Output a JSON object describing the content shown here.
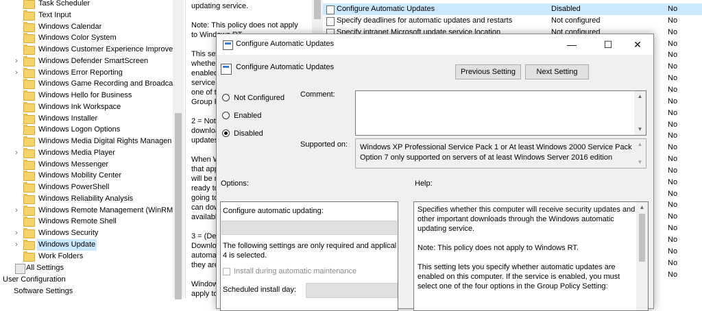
{
  "tree": {
    "items": [
      {
        "label": "Task Scheduler",
        "chev": "",
        "icon": "folder"
      },
      {
        "label": "Text Input",
        "chev": "",
        "icon": "folder"
      },
      {
        "label": "Windows Calendar",
        "chev": "",
        "icon": "folder"
      },
      {
        "label": "Windows Color System",
        "chev": "",
        "icon": "folder"
      },
      {
        "label": "Windows Customer Experience Improve",
        "chev": "",
        "icon": "folder"
      },
      {
        "label": "Windows Defender SmartScreen",
        "chev": "›",
        "icon": "folder"
      },
      {
        "label": "Windows Error Reporting",
        "chev": "›",
        "icon": "folder"
      },
      {
        "label": "Windows Game Recording and Broadca",
        "chev": "",
        "icon": "folder"
      },
      {
        "label": "Windows Hello for Business",
        "chev": "",
        "icon": "folder"
      },
      {
        "label": "Windows Ink Workspace",
        "chev": "",
        "icon": "folder"
      },
      {
        "label": "Windows Installer",
        "chev": "",
        "icon": "folder"
      },
      {
        "label": "Windows Logon Options",
        "chev": "",
        "icon": "folder"
      },
      {
        "label": "Windows Media Digital Rights Managen",
        "chev": "",
        "icon": "folder"
      },
      {
        "label": "Windows Media Player",
        "chev": "›",
        "icon": "folder"
      },
      {
        "label": "Windows Messenger",
        "chev": "",
        "icon": "folder"
      },
      {
        "label": "Windows Mobility Center",
        "chev": "",
        "icon": "folder"
      },
      {
        "label": "Windows PowerShell",
        "chev": "",
        "icon": "folder"
      },
      {
        "label": "Windows Reliability Analysis",
        "chev": "",
        "icon": "folder"
      },
      {
        "label": "Windows Remote Management (WinRM",
        "chev": "›",
        "icon": "folder"
      },
      {
        "label": "Windows Remote Shell",
        "chev": "",
        "icon": "folder"
      },
      {
        "label": "Windows Security",
        "chev": "›",
        "icon": "folder"
      },
      {
        "label": "Windows Update",
        "chev": "›",
        "icon": "folder",
        "selected": true
      },
      {
        "label": "Work Folders",
        "chev": "",
        "icon": "folder"
      }
    ],
    "all_settings": "All Settings",
    "user_configuration": "User Configuration",
    "software_settings": "Software Settings"
  },
  "description_pane": {
    "lines": [
      "updating service.",
      "",
      "Note: This policy does not apply",
      "to Windows RT.",
      "",
      "This setting lets you specify",
      "whether automatic updates are",
      "enabled on this computer. If the",
      "service is enabled, you must select",
      "one of the four options in the",
      "Group Policy Setting:",
      "",
      "    2 = Notify before",
      "download and notify before installing",
      "updates.",
      "",
      "    When Windows finds updates",
      "that apply to this computer, users",
      "will be notified that updates are",
      "ready to be downloaded. After",
      "going to Windows Update, users",
      "can download and install any",
      "available updates.",
      "",
      "    3 = (Default setting)",
      "Download the updates",
      "automatically and notify when",
      "they are ready to be installed",
      "",
      "    Windows finds updates that",
      "apply to the computer and"
    ]
  },
  "policy_list": {
    "rows": [
      {
        "name": "Configure Automatic Updates",
        "state": "Disabled",
        "comment": "No",
        "selected": true
      },
      {
        "name": "Specify deadlines for automatic updates and restarts",
        "state": "Not configured",
        "comment": "No"
      },
      {
        "name": "Specify intranet Microsoft update service location",
        "state": "Not configured",
        "comment": "No"
      }
    ],
    "no_column": [
      "No",
      "No",
      "No",
      "No",
      "No",
      "No",
      "No",
      "No",
      "No",
      "No",
      "No",
      "No",
      "No",
      "No",
      "No",
      "No",
      "No",
      "No",
      "No",
      "No",
      "No",
      "No",
      "No",
      "No"
    ]
  },
  "dialog": {
    "window_title": "Configure Automatic Updates",
    "header_title": "Configure Automatic Updates",
    "minimize": "—",
    "maximize": "☐",
    "close": "✕",
    "previous_setting": "Previous Setting",
    "next_setting": "Next Setting",
    "radio": {
      "not_configured": "Not Configured",
      "enabled": "Enabled",
      "disabled": "Disabled",
      "selected": "disabled"
    },
    "comment_label": "Comment:",
    "comment_value": "",
    "supported_on_label": "Supported on:",
    "supported_on_text": [
      "Windows XP Professional Service Pack 1 or At least Windows 2000 Service Pack 3",
      "Option 7 only supported on servers of at least Windows Server 2016 edition"
    ],
    "options_label": "Options:",
    "help_label": "Help:",
    "options": {
      "configure_label": "Configure automatic updating:",
      "configure_value": "",
      "following_settings": "The following settings are only required and applical",
      "following_settings_2": "4 is selected.",
      "install_maintenance": "Install during automatic maintenance",
      "scheduled_day_label": "Scheduled install day:"
    },
    "help_text": [
      "Specifies whether this computer will receive security updates and|other important downloads through the Windows automatic|updating service.",
      "Note: This policy does not apply to Windows RT.",
      "This setting lets you specify whether automatic updates are|enabled on this computer. If the service is enabled, you must|select one of the four options in the Group Policy Setting:"
    ]
  }
}
